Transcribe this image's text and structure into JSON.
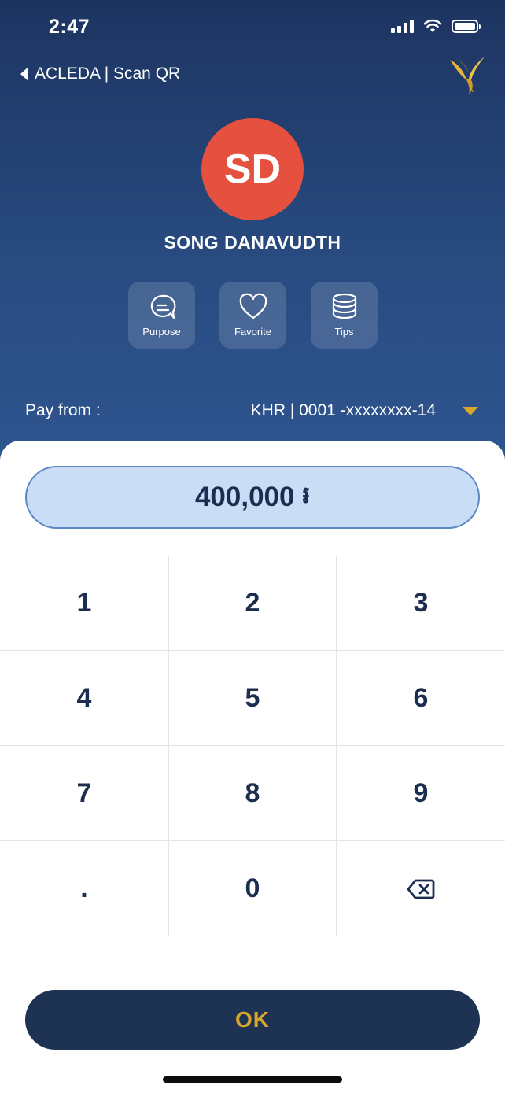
{
  "status_bar": {
    "time": "2:47"
  },
  "nav": {
    "back_label": "ACLEDA | Scan QR"
  },
  "recipient": {
    "initials": "SD",
    "name": "SONG DANAVUDTH",
    "avatar_color": "#e6513f"
  },
  "actions": [
    {
      "label": "Purpose",
      "icon": "chat-bubble-icon"
    },
    {
      "label": "Favorite",
      "icon": "heart-icon"
    },
    {
      "label": "Tips",
      "icon": "coins-icon"
    }
  ],
  "pay_from": {
    "label": "Pay from :",
    "account": "KHR | 0001 -xxxxxxxx-14"
  },
  "amount": {
    "value": "400,000",
    "currency_symbol": "៛"
  },
  "keypad": {
    "keys": [
      "1",
      "2",
      "3",
      "4",
      "5",
      "6",
      "7",
      "8",
      "9",
      ".",
      "0"
    ],
    "delete_icon": "backspace-icon"
  },
  "ok_button": {
    "label": "OK"
  },
  "colors": {
    "accent_gold": "#d7a72c",
    "header_navy": "#1d3461",
    "amount_field": "#c9ddf6",
    "ok_button_bg": "#1e3253"
  }
}
